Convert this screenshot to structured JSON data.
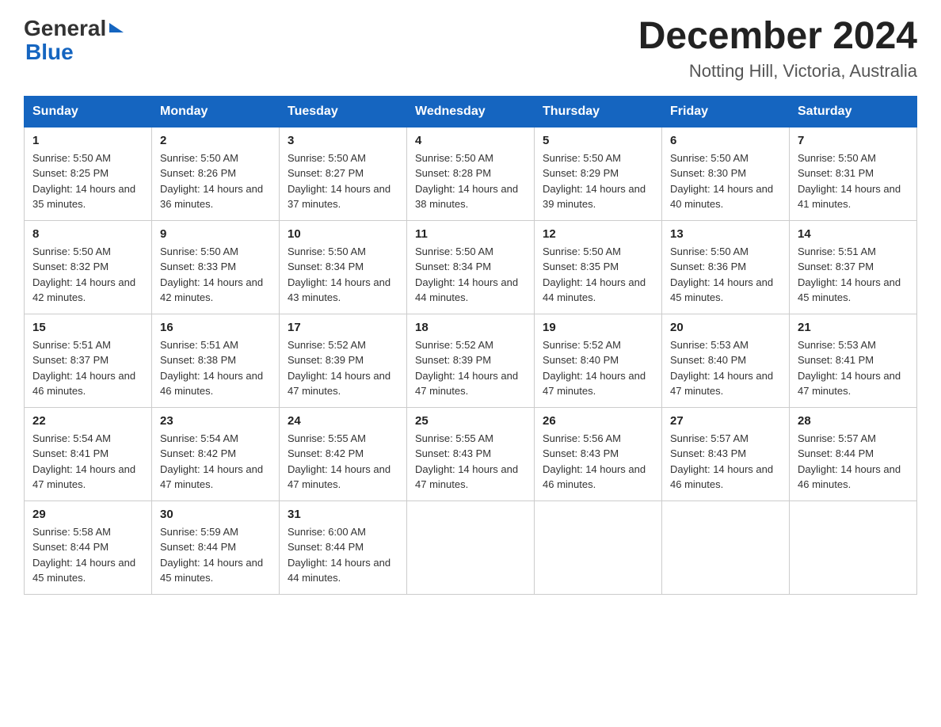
{
  "header": {
    "logo_general": "General",
    "logo_blue": "Blue",
    "month_year": "December 2024",
    "location": "Notting Hill, Victoria, Australia"
  },
  "days_of_week": [
    "Sunday",
    "Monday",
    "Tuesday",
    "Wednesday",
    "Thursday",
    "Friday",
    "Saturday"
  ],
  "weeks": [
    [
      {
        "day": "1",
        "sunrise": "Sunrise: 5:50 AM",
        "sunset": "Sunset: 8:25 PM",
        "daylight": "Daylight: 14 hours and 35 minutes."
      },
      {
        "day": "2",
        "sunrise": "Sunrise: 5:50 AM",
        "sunset": "Sunset: 8:26 PM",
        "daylight": "Daylight: 14 hours and 36 minutes."
      },
      {
        "day": "3",
        "sunrise": "Sunrise: 5:50 AM",
        "sunset": "Sunset: 8:27 PM",
        "daylight": "Daylight: 14 hours and 37 minutes."
      },
      {
        "day": "4",
        "sunrise": "Sunrise: 5:50 AM",
        "sunset": "Sunset: 8:28 PM",
        "daylight": "Daylight: 14 hours and 38 minutes."
      },
      {
        "day": "5",
        "sunrise": "Sunrise: 5:50 AM",
        "sunset": "Sunset: 8:29 PM",
        "daylight": "Daylight: 14 hours and 39 minutes."
      },
      {
        "day": "6",
        "sunrise": "Sunrise: 5:50 AM",
        "sunset": "Sunset: 8:30 PM",
        "daylight": "Daylight: 14 hours and 40 minutes."
      },
      {
        "day": "7",
        "sunrise": "Sunrise: 5:50 AM",
        "sunset": "Sunset: 8:31 PM",
        "daylight": "Daylight: 14 hours and 41 minutes."
      }
    ],
    [
      {
        "day": "8",
        "sunrise": "Sunrise: 5:50 AM",
        "sunset": "Sunset: 8:32 PM",
        "daylight": "Daylight: 14 hours and 42 minutes."
      },
      {
        "day": "9",
        "sunrise": "Sunrise: 5:50 AM",
        "sunset": "Sunset: 8:33 PM",
        "daylight": "Daylight: 14 hours and 42 minutes."
      },
      {
        "day": "10",
        "sunrise": "Sunrise: 5:50 AM",
        "sunset": "Sunset: 8:34 PM",
        "daylight": "Daylight: 14 hours and 43 minutes."
      },
      {
        "day": "11",
        "sunrise": "Sunrise: 5:50 AM",
        "sunset": "Sunset: 8:34 PM",
        "daylight": "Daylight: 14 hours and 44 minutes."
      },
      {
        "day": "12",
        "sunrise": "Sunrise: 5:50 AM",
        "sunset": "Sunset: 8:35 PM",
        "daylight": "Daylight: 14 hours and 44 minutes."
      },
      {
        "day": "13",
        "sunrise": "Sunrise: 5:50 AM",
        "sunset": "Sunset: 8:36 PM",
        "daylight": "Daylight: 14 hours and 45 minutes."
      },
      {
        "day": "14",
        "sunrise": "Sunrise: 5:51 AM",
        "sunset": "Sunset: 8:37 PM",
        "daylight": "Daylight: 14 hours and 45 minutes."
      }
    ],
    [
      {
        "day": "15",
        "sunrise": "Sunrise: 5:51 AM",
        "sunset": "Sunset: 8:37 PM",
        "daylight": "Daylight: 14 hours and 46 minutes."
      },
      {
        "day": "16",
        "sunrise": "Sunrise: 5:51 AM",
        "sunset": "Sunset: 8:38 PM",
        "daylight": "Daylight: 14 hours and 46 minutes."
      },
      {
        "day": "17",
        "sunrise": "Sunrise: 5:52 AM",
        "sunset": "Sunset: 8:39 PM",
        "daylight": "Daylight: 14 hours and 47 minutes."
      },
      {
        "day": "18",
        "sunrise": "Sunrise: 5:52 AM",
        "sunset": "Sunset: 8:39 PM",
        "daylight": "Daylight: 14 hours and 47 minutes."
      },
      {
        "day": "19",
        "sunrise": "Sunrise: 5:52 AM",
        "sunset": "Sunset: 8:40 PM",
        "daylight": "Daylight: 14 hours and 47 minutes."
      },
      {
        "day": "20",
        "sunrise": "Sunrise: 5:53 AM",
        "sunset": "Sunset: 8:40 PM",
        "daylight": "Daylight: 14 hours and 47 minutes."
      },
      {
        "day": "21",
        "sunrise": "Sunrise: 5:53 AM",
        "sunset": "Sunset: 8:41 PM",
        "daylight": "Daylight: 14 hours and 47 minutes."
      }
    ],
    [
      {
        "day": "22",
        "sunrise": "Sunrise: 5:54 AM",
        "sunset": "Sunset: 8:41 PM",
        "daylight": "Daylight: 14 hours and 47 minutes."
      },
      {
        "day": "23",
        "sunrise": "Sunrise: 5:54 AM",
        "sunset": "Sunset: 8:42 PM",
        "daylight": "Daylight: 14 hours and 47 minutes."
      },
      {
        "day": "24",
        "sunrise": "Sunrise: 5:55 AM",
        "sunset": "Sunset: 8:42 PM",
        "daylight": "Daylight: 14 hours and 47 minutes."
      },
      {
        "day": "25",
        "sunrise": "Sunrise: 5:55 AM",
        "sunset": "Sunset: 8:43 PM",
        "daylight": "Daylight: 14 hours and 47 minutes."
      },
      {
        "day": "26",
        "sunrise": "Sunrise: 5:56 AM",
        "sunset": "Sunset: 8:43 PM",
        "daylight": "Daylight: 14 hours and 46 minutes."
      },
      {
        "day": "27",
        "sunrise": "Sunrise: 5:57 AM",
        "sunset": "Sunset: 8:43 PM",
        "daylight": "Daylight: 14 hours and 46 minutes."
      },
      {
        "day": "28",
        "sunrise": "Sunrise: 5:57 AM",
        "sunset": "Sunset: 8:44 PM",
        "daylight": "Daylight: 14 hours and 46 minutes."
      }
    ],
    [
      {
        "day": "29",
        "sunrise": "Sunrise: 5:58 AM",
        "sunset": "Sunset: 8:44 PM",
        "daylight": "Daylight: 14 hours and 45 minutes."
      },
      {
        "day": "30",
        "sunrise": "Sunrise: 5:59 AM",
        "sunset": "Sunset: 8:44 PM",
        "daylight": "Daylight: 14 hours and 45 minutes."
      },
      {
        "day": "31",
        "sunrise": "Sunrise: 6:00 AM",
        "sunset": "Sunset: 8:44 PM",
        "daylight": "Daylight: 14 hours and 44 minutes."
      },
      null,
      null,
      null,
      null
    ]
  ]
}
